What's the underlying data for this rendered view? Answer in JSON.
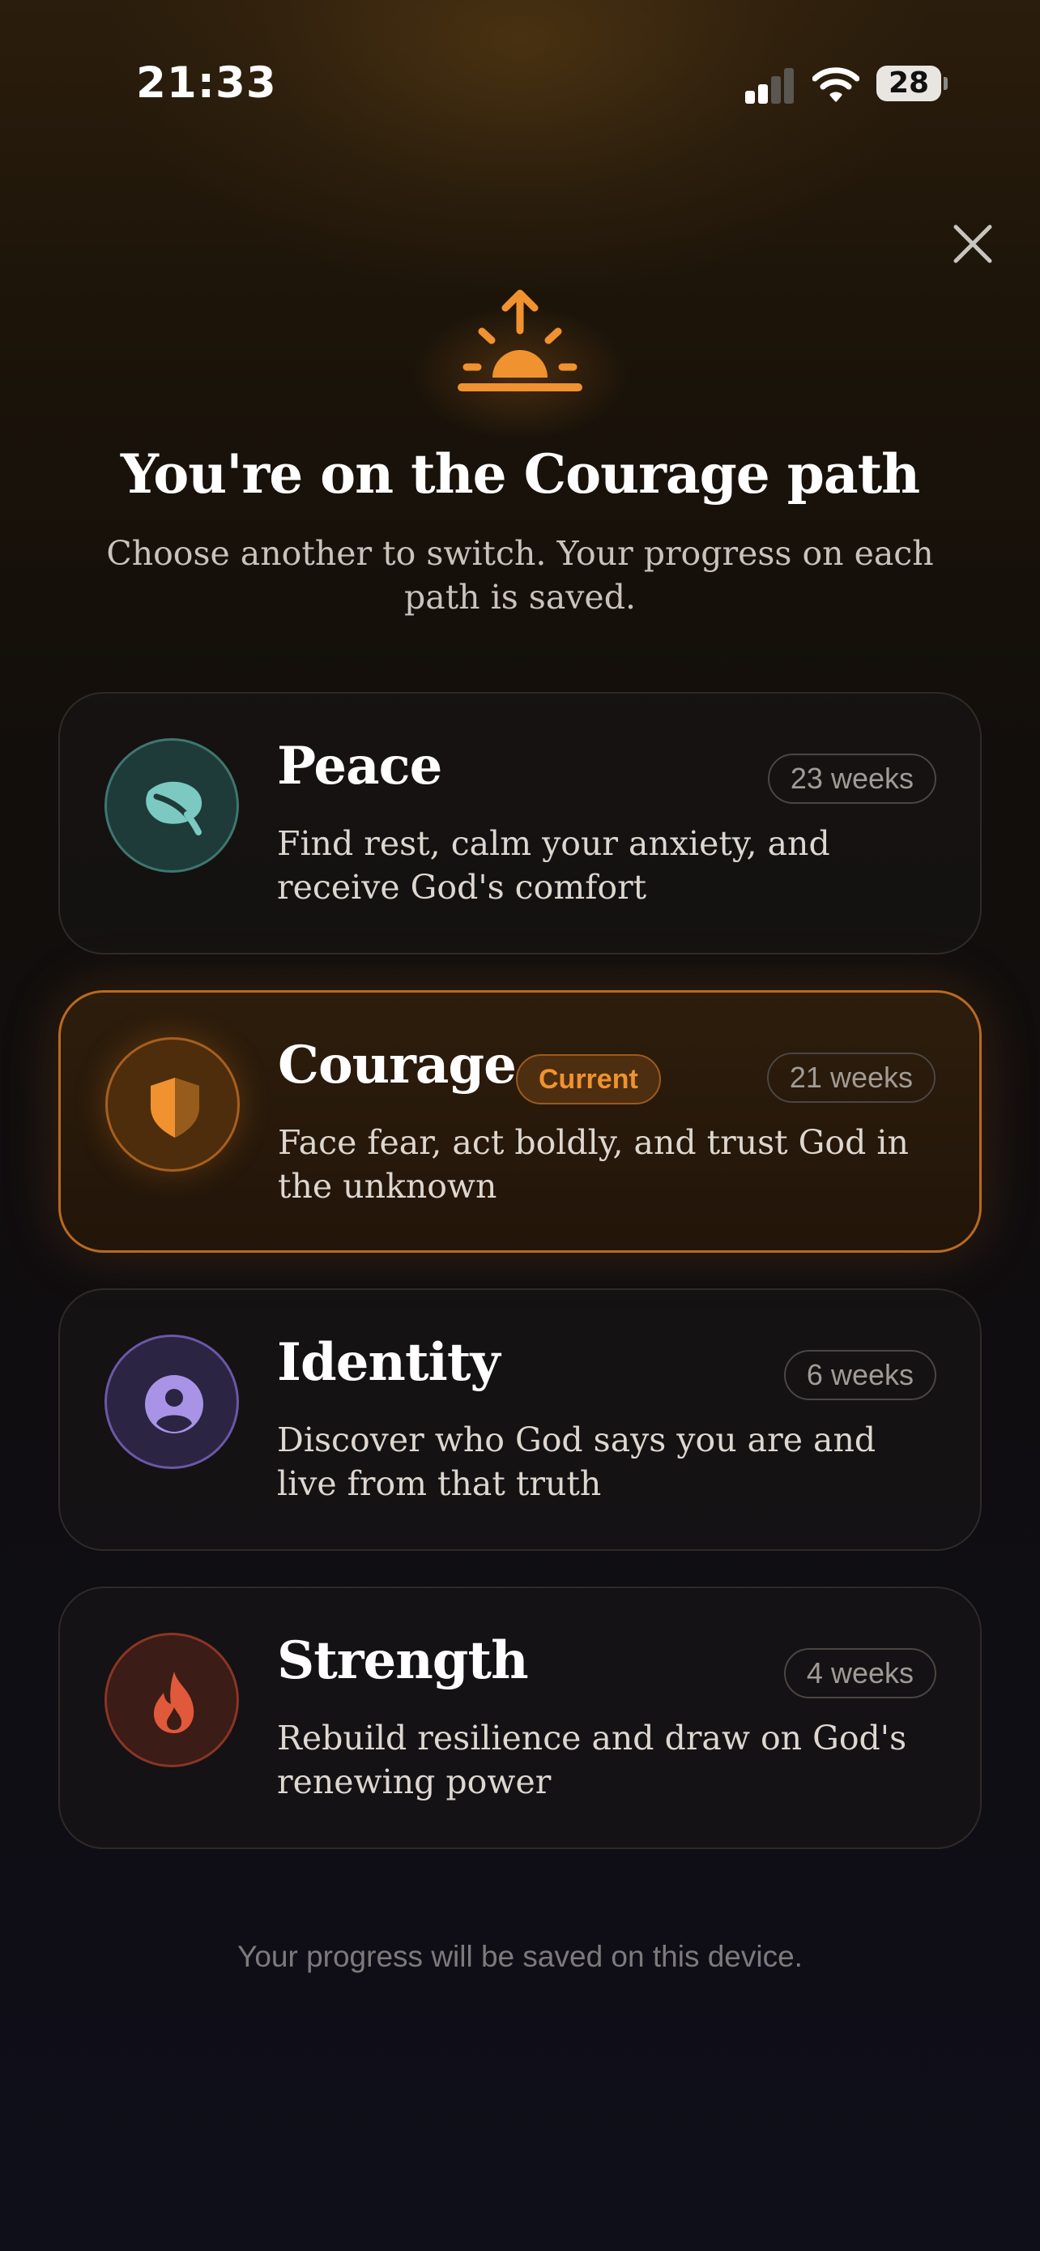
{
  "status_bar": {
    "time": "21:33",
    "battery": "28",
    "icons": [
      "cellular-signal-icon",
      "wifi-icon",
      "battery-icon"
    ]
  },
  "close": {
    "icon": "close-icon"
  },
  "header": {
    "icon": "sunrise-icon",
    "title": "You're on the Courage path",
    "subtitle": "Choose another to switch. Your progress on each path is saved."
  },
  "paths": [
    {
      "name": "Peace",
      "duration": "23 weeks",
      "description": "Find rest, calm your anxiety, and receive God's comfort",
      "icon": "leaf-icon",
      "color": "#7cc9c2",
      "current": false
    },
    {
      "name": "Courage",
      "duration": "21 weeks",
      "description": "Face fear, act boldly, and trust God in the unknown",
      "icon": "shield-icon",
      "color": "#f0922f",
      "current": true,
      "current_label": "Current"
    },
    {
      "name": "Identity",
      "duration": "6 weeks",
      "description": "Discover who God says you are and live from that truth",
      "icon": "person-icon",
      "color": "#a993e6",
      "current": false
    },
    {
      "name": "Strength",
      "duration": "4 weeks",
      "description": "Rebuild resilience and draw on God's renewing power",
      "icon": "flame-icon",
      "color": "#e0593a",
      "current": false
    }
  ],
  "footer": {
    "note": "Your progress will be saved on this device."
  },
  "colors": {
    "accent": "#f0922f",
    "background": "#0f0f1a",
    "text_primary": "#ffffff",
    "text_secondary": "#c9c3bc"
  }
}
